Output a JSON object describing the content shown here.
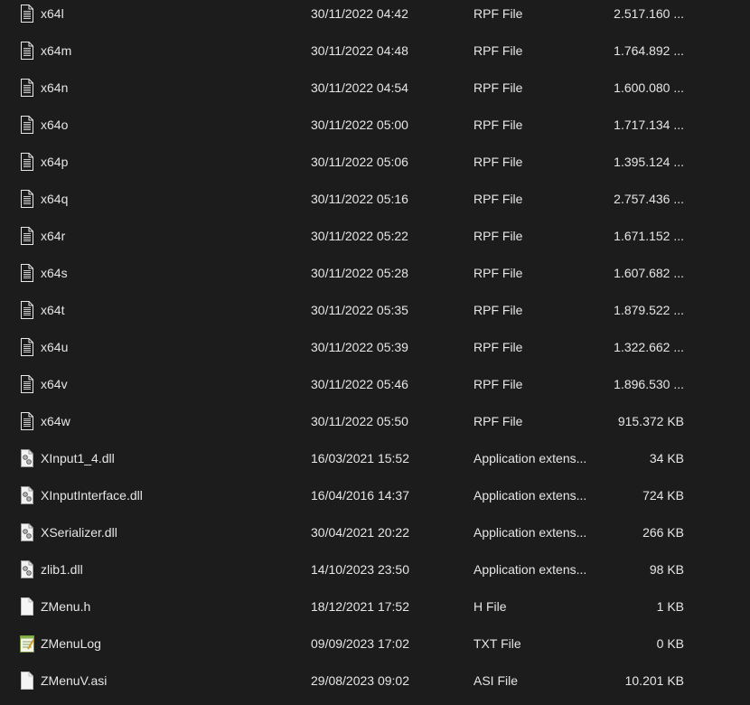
{
  "files": [
    {
      "name": "x64l",
      "date": "30/11/2022 04:42",
      "type": "RPF File",
      "size": "2.517.160 ...",
      "icon": "document-lines-icon"
    },
    {
      "name": "x64m",
      "date": "30/11/2022 04:48",
      "type": "RPF File",
      "size": "1.764.892 ...",
      "icon": "document-lines-icon"
    },
    {
      "name": "x64n",
      "date": "30/11/2022 04:54",
      "type": "RPF File",
      "size": "1.600.080 ...",
      "icon": "document-lines-icon"
    },
    {
      "name": "x64o",
      "date": "30/11/2022 05:00",
      "type": "RPF File",
      "size": "1.717.134 ...",
      "icon": "document-lines-icon"
    },
    {
      "name": "x64p",
      "date": "30/11/2022 05:06",
      "type": "RPF File",
      "size": "1.395.124 ...",
      "icon": "document-lines-icon"
    },
    {
      "name": "x64q",
      "date": "30/11/2022 05:16",
      "type": "RPF File",
      "size": "2.757.436 ...",
      "icon": "document-lines-icon"
    },
    {
      "name": "x64r",
      "date": "30/11/2022 05:22",
      "type": "RPF File",
      "size": "1.671.152 ...",
      "icon": "document-lines-icon"
    },
    {
      "name": "x64s",
      "date": "30/11/2022 05:28",
      "type": "RPF File",
      "size": "1.607.682 ...",
      "icon": "document-lines-icon"
    },
    {
      "name": "x64t",
      "date": "30/11/2022 05:35",
      "type": "RPF File",
      "size": "1.879.522 ...",
      "icon": "document-lines-icon"
    },
    {
      "name": "x64u",
      "date": "30/11/2022 05:39",
      "type": "RPF File",
      "size": "1.322.662 ...",
      "icon": "document-lines-icon"
    },
    {
      "name": "x64v",
      "date": "30/11/2022 05:46",
      "type": "RPF File",
      "size": "1.896.530 ...",
      "icon": "document-lines-icon"
    },
    {
      "name": "x64w",
      "date": "30/11/2022 05:50",
      "type": "RPF File",
      "size": "915.372 KB",
      "icon": "document-lines-icon"
    },
    {
      "name": "XInput1_4.dll",
      "date": "16/03/2021 15:52",
      "type": "Application extens...",
      "size": "34 KB",
      "icon": "dll-gear-icon"
    },
    {
      "name": "XInputInterface.dll",
      "date": "16/04/2016 14:37",
      "type": "Application extens...",
      "size": "724 KB",
      "icon": "dll-gear-icon"
    },
    {
      "name": "XSerializer.dll",
      "date": "30/04/2021 20:22",
      "type": "Application extens...",
      "size": "266 KB",
      "icon": "dll-gear-icon"
    },
    {
      "name": "zlib1.dll",
      "date": "14/10/2023 23:50",
      "type": "Application extens...",
      "size": "98 KB",
      "icon": "dll-gear-icon"
    },
    {
      "name": "ZMenu.h",
      "date": "18/12/2021 17:52",
      "type": "H File",
      "size": "1 KB",
      "icon": "blank-document-icon"
    },
    {
      "name": "ZMenuLog",
      "date": "09/09/2023 17:02",
      "type": "TXT File",
      "size": "0 KB",
      "icon": "notepad-document-icon"
    },
    {
      "name": "ZMenuV.asi",
      "date": "29/08/2023 09:02",
      "type": "ASI File",
      "size": "10.201 KB",
      "icon": "blank-document-icon"
    }
  ]
}
